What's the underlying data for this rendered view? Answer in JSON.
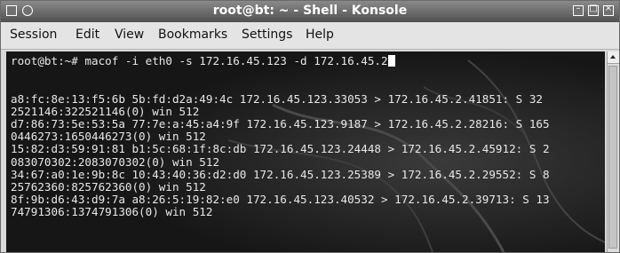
{
  "window": {
    "title": "root@bt: ~ - Shell - Konsole"
  },
  "menubar": {
    "items": [
      "Session",
      "Edit",
      "View",
      "Bookmarks",
      "Settings",
      "Help"
    ]
  },
  "terminal": {
    "prompt": "root@bt:~# ",
    "command": "macof -i eth0 -s 172.16.45.123 -d 172.16.45.2",
    "output_lines": [
      "",
      "",
      "a8:fc:8e:13:f5:6b 5b:fd:d2a:49:4c 172.16.45.123.33053 > 172.16.45.2.41851: S 32",
      "2521146:322521146(0) win 512",
      "d7:86:73:5e:53:5a 77:7e:a:45:a4:9f 172.16.45.123.9187 > 172.16.45.2.28216: S 165",
      "0446273:1650446273(0) win 512",
      "15:82:d3:59:91:81 b1:5c:68:1f:8c:db 172.16.45.123.24448 > 172.16.45.2.45912: S 2",
      "083070302:2083070302(0) win 512",
      "34:67:a0:1e:9b:8c 10:43:40:36:d2:d0 172.16.45.123.25389 > 172.16.45.2.29552: S 8",
      "25762360:825762360(0) win 512",
      "8f:9b:d6:43:d9:7a a8:26:5:19:82:e0 172.16.45.123.40532 > 172.16.45.2.39713: S 13",
      "74791306:1374791306(0) win 512"
    ]
  },
  "icons": {
    "window_menu": "window-menu-icon",
    "sticky": "sticky-icon",
    "minimize": "minimize-icon",
    "maximize": "maximize-icon",
    "close": "close-icon",
    "scroll_up": "scroll-up-arrow-icon"
  },
  "colors": {
    "terminal_bg": "#161616",
    "terminal_fg": "#e8e8e8",
    "titlebar": "#5c5c5c"
  }
}
